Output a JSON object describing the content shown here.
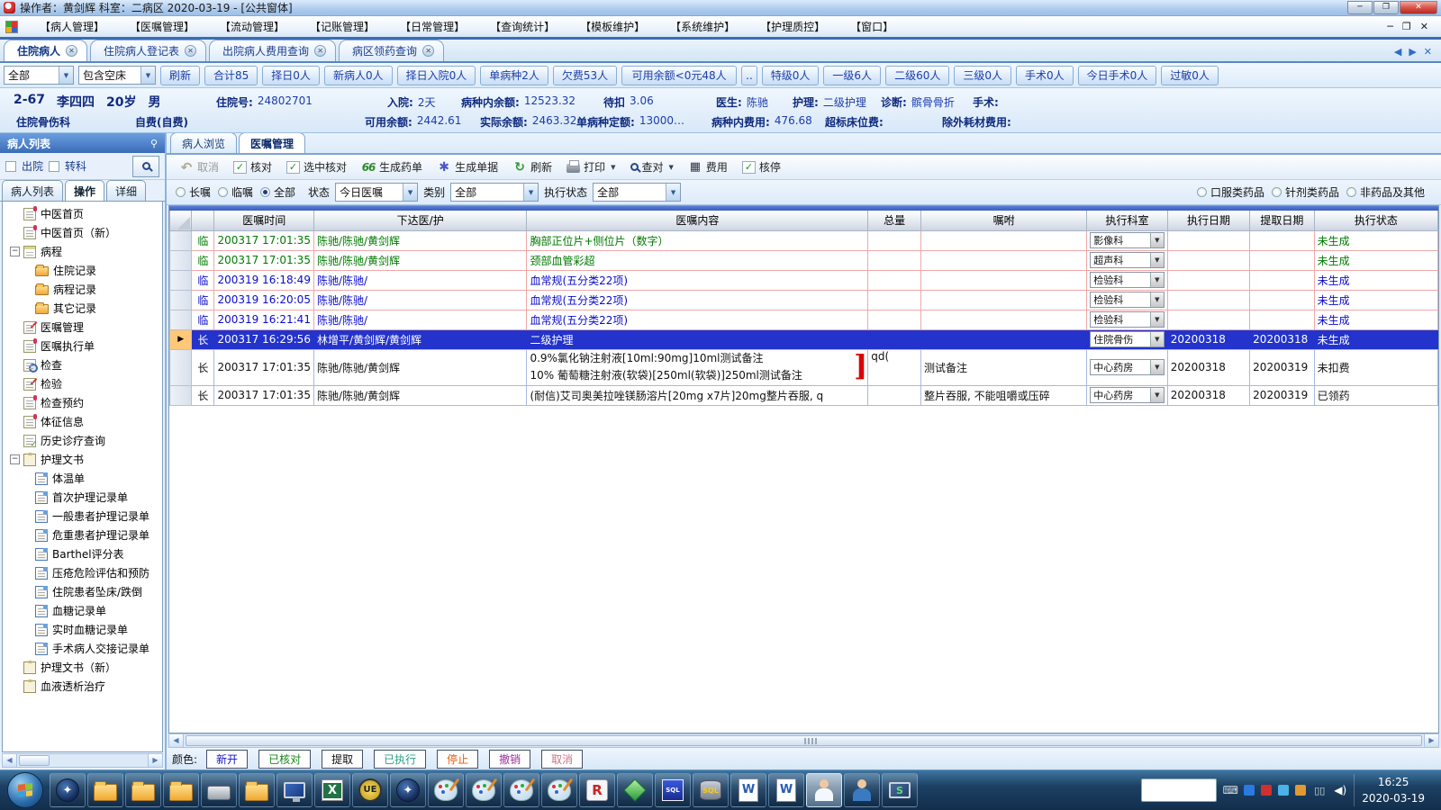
{
  "window": {
    "title": "操作者：黄剑辉  科室：二病区  2020-03-19   - [公共窗体]",
    "controls": [
      "─",
      "❐",
      "✕"
    ],
    "mdi_controls": [
      "─",
      "❐",
      "✕"
    ],
    "tab_nav": [
      "◀",
      "▶",
      "✕"
    ]
  },
  "menu": {
    "items": [
      "【病人管理】",
      "【医嘱管理】",
      "【流动管理】",
      "【记账管理】",
      "【日常管理】",
      "【查询统计】",
      "【模板维护】",
      "【系统维护】",
      "【护理质控】",
      "【窗口】"
    ]
  },
  "doc_tabs": [
    {
      "label": "住院病人",
      "active": true
    },
    {
      "label": "住院病人登记表",
      "active": false
    },
    {
      "label": "出院病人费用查询",
      "active": false
    },
    {
      "label": "病区领药查询",
      "active": false
    }
  ],
  "filter_bar": {
    "ward_select": "全部",
    "bed_select": "包含空床",
    "buttons": [
      "刷新",
      "合计85",
      "择日0人",
      "新病人0人",
      "择日入院0人",
      "单病种2人",
      "欠费53人"
    ],
    "balance_button": "可用余额<0元48人",
    "more_button": "..",
    "level_buttons": [
      "特级0人",
      "一级6人",
      "二级60人",
      "三级0人",
      "手术0人",
      "今日手术0人",
      "过敏0人"
    ]
  },
  "patient": {
    "bed": "2-67",
    "name": "李四四",
    "age": "20岁",
    "gender": "男",
    "admission_no_label": "住院号:",
    "admission_no": "24802701",
    "admit_label": "入院:",
    "admit_days": "2天",
    "disease_balance_label": "病种内余额:",
    "disease_balance": "12523.32",
    "pending_label": "待扣",
    "pending": "3.06",
    "doctor_label": "医生:",
    "doctor": "陈驰",
    "nursing_label": "护理:",
    "nursing": "二级护理",
    "diagnosis_label": "诊断:",
    "diagnosis": "髌骨骨折",
    "surgery_label": "手术:",
    "dept": "住院骨伤科",
    "pay_type": "自费(自费)",
    "avail_label": "可用余额:",
    "avail": "2442.61",
    "actual_label": "实际余额:",
    "actual": "2463.32",
    "quota_label": "单病种定额:",
    "quota": "13000…",
    "disease_fee_label": "病种内费用:",
    "disease_fee": "476.68",
    "over_bed_label": "超标床位费:",
    "excl_label": "除外耗材费用:"
  },
  "sidebar": {
    "title": "病人列表",
    "checkboxes": [
      "出院",
      "转科"
    ],
    "tabs": [
      "病人列表",
      "操作",
      "详细"
    ],
    "active_tab": "操作",
    "tree": [
      {
        "label": "中医首页",
        "icon": "doc-red",
        "indent": 1
      },
      {
        "label": "中医首页（新）",
        "icon": "doc-red",
        "indent": 1
      },
      {
        "label": "病程",
        "icon": "calendar",
        "indent": 1,
        "expanded": true
      },
      {
        "label": "住院记录",
        "icon": "folder",
        "indent": 2
      },
      {
        "label": "病程记录",
        "icon": "folder",
        "indent": 2
      },
      {
        "label": "其它记录",
        "icon": "folder",
        "indent": 2
      },
      {
        "label": "医嘱管理",
        "icon": "doc-pen",
        "indent": 1
      },
      {
        "label": "医嘱执行单",
        "icon": "doc-red",
        "indent": 1
      },
      {
        "label": "检查",
        "icon": "doc-search",
        "indent": 1
      },
      {
        "label": "检验",
        "icon": "doc-pen",
        "indent": 1
      },
      {
        "label": "检查预约",
        "icon": "doc-red",
        "indent": 1
      },
      {
        "label": "体征信息",
        "icon": "doc-red",
        "indent": 1
      },
      {
        "label": "历史诊疗查询",
        "icon": "doc-check",
        "indent": 1
      },
      {
        "label": "护理文书",
        "icon": "clipboard",
        "indent": 1,
        "expanded": true
      },
      {
        "label": "体温单",
        "icon": "doc-blue",
        "indent": 2
      },
      {
        "label": "首次护理记录单",
        "icon": "doc-blue",
        "indent": 2
      },
      {
        "label": "一般患者护理记录单",
        "icon": "doc-blue",
        "indent": 2
      },
      {
        "label": "危重患者护理记录单",
        "icon": "doc-blue",
        "indent": 2
      },
      {
        "label": "Barthel评分表",
        "icon": "doc-blue",
        "indent": 2
      },
      {
        "label": "压疮危险评估和预防",
        "icon": "doc-blue",
        "indent": 2
      },
      {
        "label": "住院患者坠床/跌倒",
        "icon": "doc-blue",
        "indent": 2
      },
      {
        "label": "血糖记录单",
        "icon": "doc-blue",
        "indent": 2
      },
      {
        "label": "实时血糖记录单",
        "icon": "doc-blue",
        "indent": 2
      },
      {
        "label": "手术病人交接记录单",
        "icon": "doc-blue",
        "indent": 2
      },
      {
        "label": "护理文书（新）",
        "icon": "clipboard",
        "indent": 1
      },
      {
        "label": "血液透析治疗",
        "icon": "clipboard",
        "indent": 1
      }
    ]
  },
  "main": {
    "tabs": [
      {
        "label": "病人浏览",
        "active": false
      },
      {
        "label": "医嘱管理",
        "active": true
      }
    ],
    "toolbar": [
      {
        "label": "取消",
        "icon": "undo-icon",
        "disabled": true
      },
      {
        "label": "核对",
        "icon": "check-icon"
      },
      {
        "label": "选中核对",
        "icon": "check-icon"
      },
      {
        "label": "生成药单",
        "icon": "binoculars-icon"
      },
      {
        "label": "生成单据",
        "icon": "gear-icon"
      },
      {
        "label": "刷新",
        "icon": "refresh-icon"
      },
      {
        "label": "打印",
        "icon": "printer-icon",
        "dropdown": true
      },
      {
        "label": "查对",
        "icon": "magnifier-icon",
        "dropdown": true
      },
      {
        "label": "费用",
        "icon": "calculator-icon"
      },
      {
        "label": "核停",
        "icon": "check-icon"
      }
    ],
    "filters": {
      "order_type_radios": [
        {
          "label": "长嘱",
          "checked": false
        },
        {
          "label": "临嘱",
          "checked": false
        },
        {
          "label": "全部",
          "checked": true
        }
      ],
      "status_label": "状态",
      "status_value": "今日医嘱",
      "category_label": "类别",
      "category_value": "全部",
      "exec_label": "执行状态",
      "exec_value": "全部",
      "drug_radios": [
        {
          "label": "口服类药品",
          "checked": false
        },
        {
          "label": "针剂类药品",
          "checked": false
        },
        {
          "label": "非药品及其他",
          "checked": false
        }
      ]
    },
    "table": {
      "columns": [
        "",
        "",
        "医嘱时间",
        "下达医/护",
        "医嘱内容",
        "总量",
        "嘱咐",
        "执行科室",
        "执行日期",
        "提取日期",
        "执行状态"
      ],
      "rows": [
        {
          "type": "临",
          "time": "200317 17:01:35",
          "doctors": "陈驰/陈驰/黄剑辉",
          "content": "胸部正位片+侧位片（数字）",
          "total": "",
          "note": "",
          "dept": "影像科",
          "exec_date": "",
          "extract_date": "",
          "status": "未生成",
          "color": "green",
          "border": "pink"
        },
        {
          "type": "临",
          "time": "200317 17:01:35",
          "doctors": "陈驰/陈驰/黄剑辉",
          "content": "颈部血管彩超",
          "total": "",
          "note": "",
          "dept": "超声科",
          "exec_date": "",
          "extract_date": "",
          "status": "未生成",
          "color": "green",
          "border": "pink"
        },
        {
          "type": "临",
          "time": "200319 16:18:49",
          "doctors": "陈驰/陈驰/",
          "content": "血常规(五分类22项)",
          "total": "",
          "note": "",
          "dept": "检验科",
          "exec_date": "",
          "extract_date": "",
          "status": "未生成",
          "color": "blue",
          "border": "pink"
        },
        {
          "type": "临",
          "time": "200319 16:20:05",
          "doctors": "陈驰/陈驰/",
          "content": "血常规(五分类22项)",
          "total": "",
          "note": "",
          "dept": "检验科",
          "exec_date": "",
          "extract_date": "",
          "status": "未生成",
          "color": "blue",
          "border": "pink"
        },
        {
          "type": "临",
          "time": "200319 16:21:41",
          "doctors": "陈驰/陈驰/",
          "content": "血常规(五分类22项)",
          "total": "",
          "note": "",
          "dept": "检验科",
          "exec_date": "",
          "extract_date": "",
          "status": "未生成",
          "color": "blue",
          "border": "pink"
        },
        {
          "type": "长",
          "time": "200317 16:29:56",
          "doctors": "林增平/黄剑辉/黄剑辉",
          "content": "二级护理",
          "total": "",
          "note": "",
          "dept": "住院骨伤",
          "exec_date": "20200318",
          "extract_date": "20200318",
          "status": "未生成",
          "color": "white",
          "border": "pink",
          "selected": true
        },
        {
          "type": "长",
          "time": "200317 17:01:35",
          "doctors": "陈驰/陈驰/黄剑辉",
          "content_lines": [
            "0.9%氯化钠注射液[10ml:90mg]10ml测试备注",
            "10% 葡萄糖注射液(软袋)[250ml(软袋)]250ml测试备注"
          ],
          "group_bracket": "]",
          "total": "qd(",
          "note": "测试备注",
          "dept": "中心药房",
          "exec_date": "20200318",
          "extract_date": "20200319",
          "status": "未扣费",
          "color": "black",
          "border": "blue"
        },
        {
          "type": "长",
          "time": "200317 17:01:35",
          "doctors": "陈驰/陈驰/黄剑辉",
          "content": "(耐信)艾司奥美拉唑镁肠溶片[20mg x7片]20mg整片吞服, q",
          "total": "",
          "note": "整片吞服, 不能咀嚼或压碎",
          "dept": "中心药房",
          "exec_date": "20200318",
          "extract_date": "20200319",
          "status": "已领药",
          "color": "black",
          "border": "blue"
        }
      ]
    },
    "legend": {
      "label": "颜色:",
      "items": [
        {
          "label": "新开",
          "color": "#1515c8"
        },
        {
          "label": "已核对",
          "color": "#18871b"
        },
        {
          "label": "提取",
          "color": "#111111"
        },
        {
          "label": "已执行",
          "color": "#2aa188"
        },
        {
          "label": "停止",
          "color": "#e85d10"
        },
        {
          "label": "撤销",
          "color": "#a0309a"
        },
        {
          "label": "取消",
          "color": "#cc7788"
        }
      ]
    }
  },
  "taskbar": {
    "buttons": [
      {
        "name": "start-button",
        "kind": "start"
      },
      {
        "name": "compass-app",
        "kind": "compass"
      },
      {
        "name": "folder-window-1",
        "kind": "folder"
      },
      {
        "name": "folder-window-2",
        "kind": "folder"
      },
      {
        "name": "folder-window-3",
        "kind": "folder"
      },
      {
        "name": "drive-window",
        "kind": "drive"
      },
      {
        "name": "folder-window-4",
        "kind": "folder"
      },
      {
        "name": "my-computer",
        "kind": "monitor"
      },
      {
        "name": "excel-app",
        "kind": "excel",
        "glyph": ""
      },
      {
        "name": "ultraedit-app",
        "kind": "ue",
        "glyph": "UE"
      },
      {
        "name": "compass-app-2",
        "kind": "compass"
      },
      {
        "name": "paint-app-1",
        "kind": "paint"
      },
      {
        "name": "paint-app-2",
        "kind": "paint"
      },
      {
        "name": "paint-app-3",
        "kind": "paint"
      },
      {
        "name": "paint-app-4",
        "kind": "paint"
      },
      {
        "name": "remote-r-app",
        "kind": "r",
        "glyph": "R"
      },
      {
        "name": "gem-app",
        "kind": "gem"
      },
      {
        "name": "sql-query-app",
        "kind": "sqlq",
        "glyph": "SQL"
      },
      {
        "name": "sql-server-app",
        "kind": "sql",
        "glyph": "SQL"
      },
      {
        "name": "word-doc-1",
        "kind": "word",
        "glyph": "W"
      },
      {
        "name": "word-doc-2",
        "kind": "word",
        "glyph": "W"
      },
      {
        "name": "his-nurse-app",
        "kind": "nurse",
        "active": true
      },
      {
        "name": "his-doctor-app",
        "kind": "doctor"
      },
      {
        "name": "monitor-s-app",
        "kind": "mons",
        "glyph": "S"
      }
    ],
    "tray": {
      "icons": [
        {
          "name": "keyboard-icon",
          "glyph": "⌨",
          "cls": "ti-kb"
        },
        {
          "name": "magnifier-tray-icon",
          "glyph": "",
          "cls": "ti-box",
          "color": "#2a7ae0"
        },
        {
          "name": "security-tray-icon",
          "glyph": "",
          "cls": "ti-box",
          "color": "#d03030"
        },
        {
          "name": "color-tray-icon-1",
          "glyph": "",
          "cls": "ti-box",
          "color": "#4ab4e8"
        },
        {
          "name": "color-tray-icon-2",
          "glyph": "",
          "cls": "ti-box",
          "color": "#e09a30"
        },
        {
          "name": "network-icon",
          "glyph": "▯▯",
          "cls": "ti-net"
        },
        {
          "name": "volume-icon",
          "glyph": "◀)",
          "cls": "ti-vol"
        }
      ],
      "time": "16:25",
      "date": "2020-03-19"
    }
  }
}
